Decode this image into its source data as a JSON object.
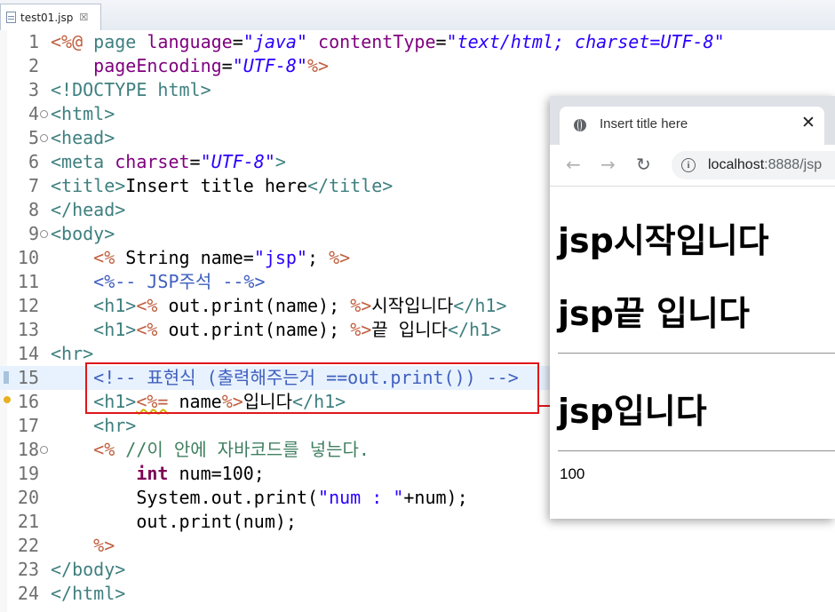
{
  "editor_tab": {
    "filename": "test01.jsp",
    "close": "☒"
  },
  "lines": [
    {
      "num": "1",
      "fold": ""
    },
    {
      "num": "2",
      "fold": ""
    },
    {
      "num": "3",
      "fold": ""
    },
    {
      "num": "4",
      "fold": "⊖"
    },
    {
      "num": "5",
      "fold": "⊖"
    },
    {
      "num": "6",
      "fold": ""
    },
    {
      "num": "7",
      "fold": ""
    },
    {
      "num": "8",
      "fold": ""
    },
    {
      "num": "9",
      "fold": "⊖"
    },
    {
      "num": "10",
      "fold": ""
    },
    {
      "num": "11",
      "fold": ""
    },
    {
      "num": "12",
      "fold": ""
    },
    {
      "num": "13",
      "fold": ""
    },
    {
      "num": "14",
      "fold": ""
    },
    {
      "num": "15",
      "fold": ""
    },
    {
      "num": "16",
      "fold": ""
    },
    {
      "num": "17",
      "fold": ""
    },
    {
      "num": "18",
      "fold": "⊖"
    },
    {
      "num": "19",
      "fold": ""
    },
    {
      "num": "20",
      "fold": ""
    },
    {
      "num": "21",
      "fold": ""
    },
    {
      "num": "22",
      "fold": ""
    },
    {
      "num": "23",
      "fold": ""
    },
    {
      "num": "24",
      "fold": ""
    }
  ],
  "code": {
    "l1": [
      "<%@",
      " page ",
      "language",
      "=",
      "\"java\"",
      " ",
      "contentType",
      "=",
      "\"text/html; charset=UTF-8\""
    ],
    "l2": [
      "    ",
      "pageEncoding",
      "=",
      "\"UTF-8\"",
      "%>"
    ],
    "l3": [
      "<!DOCTYPE html>"
    ],
    "l4": [
      "<html>"
    ],
    "l5": [
      "<head>"
    ],
    "l6": [
      "<meta ",
      "charset",
      "=",
      "\"UTF-8\"",
      ">"
    ],
    "l7": [
      "<title>",
      "Insert title here",
      "</title>"
    ],
    "l8": [
      "</head>"
    ],
    "l9": [
      "<body>"
    ],
    "l10": [
      "    ",
      "<%",
      " String name=",
      "\"jsp\"",
      "; ",
      "%>"
    ],
    "l11": [
      "    ",
      "<%-- JSP주석 --%>"
    ],
    "l12": [
      "    ",
      "<h1>",
      "<%",
      " out.print(name); ",
      "%>",
      "시작입니다",
      "</h1>"
    ],
    "l13": [
      "    ",
      "<h1>",
      "<%",
      " out.print(name); ",
      "%>",
      "끝 입니다",
      "</h1>"
    ],
    "l14": [
      "<hr>"
    ],
    "l15": [
      "    ",
      "<!-- 표현식 (출력해주는거 ==out.print()) -->"
    ],
    "l16": [
      "    ",
      "<h1>",
      "<%=",
      " name",
      "%>",
      "입니다",
      "</h1>"
    ],
    "l17": [
      "    ",
      "<hr>"
    ],
    "l18": [
      "    ",
      "<%",
      " //이 안에 자바코드를 넣는다."
    ],
    "l19": [
      "        ",
      "int",
      " num=100;"
    ],
    "l20": [
      "        ",
      "System.out.print(",
      "\"num : \"",
      "+num);"
    ],
    "l21": [
      "        ",
      "out.print(num);"
    ],
    "l22": [
      "    ",
      "%>"
    ],
    "l23": [
      "</body>"
    ],
    "l24": [
      "</html>"
    ]
  },
  "browser": {
    "tab_title": "Insert title here",
    "tab_close": "✕",
    "back": "←",
    "forward": "→",
    "reload": "↻",
    "info": "i",
    "url_host": "localhost",
    "url_rest": ":8888/jsp",
    "heading1": "jsp시작입니다",
    "heading2": "jsp끝 입니다",
    "heading3": "jsp입니다",
    "output": "100"
  },
  "colors": {
    "annotation_red": "#e0161b",
    "current_line": "#e8f2fe"
  }
}
